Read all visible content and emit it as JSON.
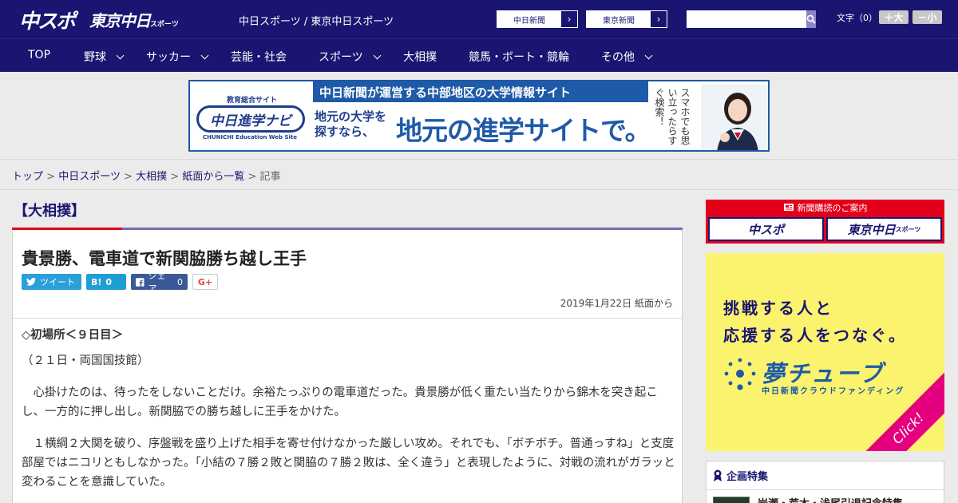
{
  "header": {
    "logo_main": "中スポ",
    "logo_sub": "東京中日",
    "logo_sub_small": "スポーツ",
    "site_title": "中日スポーツ / 東京中日スポーツ",
    "links": [
      "中日新聞",
      "東京新聞"
    ],
    "search_placeholder": "",
    "font_size_label": "文字（0）",
    "font_bigger": "＋大",
    "font_smaller": "－小"
  },
  "nav": {
    "items": [
      {
        "label": "TOP",
        "dropdown": false
      },
      {
        "label": "野球",
        "dropdown": true
      },
      {
        "label": "サッカー",
        "dropdown": true
      },
      {
        "label": "芸能・社会",
        "dropdown": false
      },
      {
        "label": "スポーツ",
        "dropdown": true
      },
      {
        "label": "大相撲",
        "dropdown": false
      },
      {
        "label": "競馬・ボート・競輪",
        "dropdown": false
      },
      {
        "label": "その他",
        "dropdown": true
      }
    ]
  },
  "banner": {
    "logo_tag": "教育総合サイト",
    "logo_name": "中日進学ナビ",
    "logo_foot": "CHUNICHI Education Web Site",
    "top_text": "中日新聞が運営する中部地区の大学情報サイト",
    "small_text_1": "地元の大学を",
    "small_text_2": "探すなら、",
    "big_text": "地元の進学サイトで。",
    "vertical_text": "スマホでも思い立ったらすぐ検索！"
  },
  "breadcrumb": {
    "items": [
      "トップ",
      "中日スポーツ",
      "大相撲",
      "紙面から一覧"
    ],
    "current": "記事",
    "separator": ">"
  },
  "article": {
    "category": "【大相撲】",
    "title": "貴景勝、電車道で新関脇勝ち越し王手",
    "share": {
      "tweet": "ツイート",
      "hatena_count": "0",
      "facebook": "シェア",
      "facebook_count": "0",
      "google_plus": "G+"
    },
    "date": "2019年1月22日 紙面から",
    "subhead": "◇初場所＜９日目＞",
    "venue": "（２１日・両国国技館）",
    "para1": "　心掛けたのは、待ったをしないことだけ。余裕たっぷりの電車道だった。貴景勝が低く重たい当たりから錦木を突き起こし、一方的に押し出し。新関脇での勝ち越しに王手をかけた。",
    "para2": "　１横綱２大関を破り、序盤戦を盛り上げた相手を寄せ付けなかった厳しい攻め。それでも、「ボチボチ。普通っすね」と支度部屋ではニコリともしなかった。「小結の７勝２敗と関脇の７勝２敗は、全く違う」と表現したように、対戦の流れがガラッと変わることを意識していた。"
  },
  "sidebar": {
    "subscribe_head": "新聞購読のご案内",
    "subscribe_logo_1": "中スポ",
    "subscribe_logo_2": "東京中日",
    "subscribe_logo_2_small": "スポーツ",
    "ad_line1": "挑戦する人と",
    "ad_line2": "応援する人をつなぐ。",
    "ad_brand": "夢チューブ",
    "ad_brand_sub": "中日新聞クラウドファンディング",
    "ad_click": "Click!",
    "feature_head": "企画特集",
    "feature_item": "岩瀬・荒木・浅尾引退記念特集"
  },
  "colors": {
    "header_bg": "#1a1570",
    "accent_red": "#e2001a",
    "accent_purple": "#7869b0",
    "ad_yellow": "#fbf36d",
    "ad_pink": "#e4007f"
  }
}
